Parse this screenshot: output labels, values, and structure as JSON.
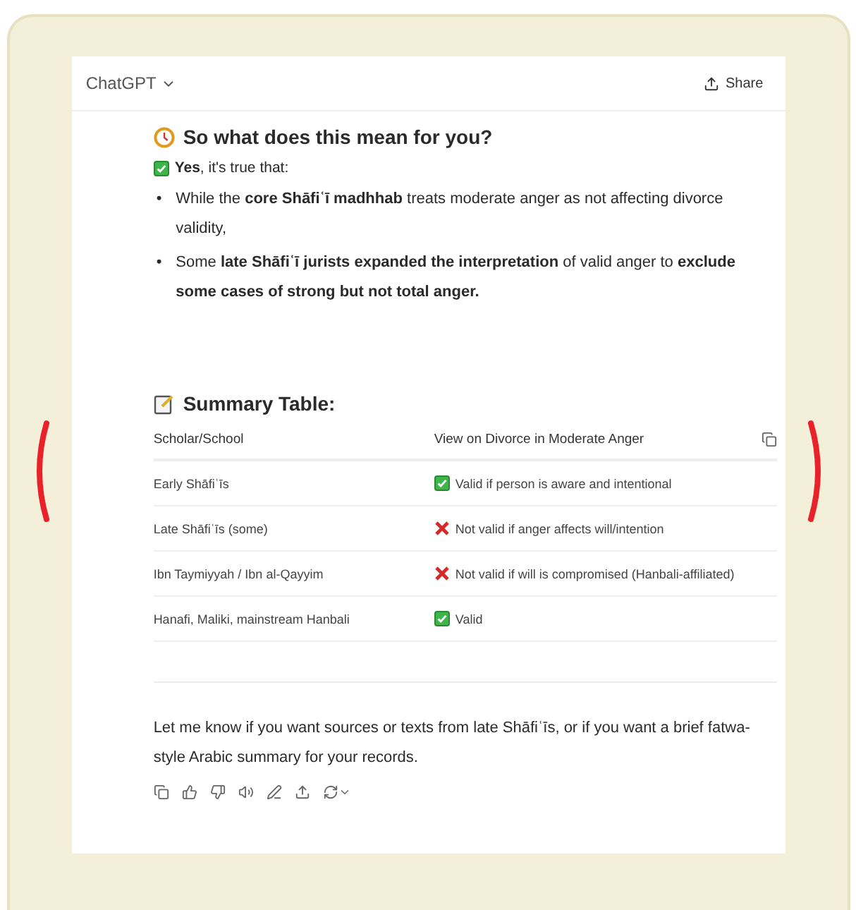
{
  "header": {
    "title": "ChatGPT",
    "share": "Share"
  },
  "section": {
    "heading": "So what does this mean for you?",
    "intro": "**Yes**, it's true that:",
    "bullets": [
      {
        "marker": "•",
        "text": "While the **core Shāfiʿī madhhab** treats moderate anger as not affecting divorce validity,"
      },
      {
        "marker": "•",
        "text": "Some **late Shāfiʿī jurists expanded the interpretation** of valid anger to **exclude some cases of strong but not total anger.**"
      }
    ]
  },
  "summary": {
    "heading": "Summary Table:",
    "columns": [
      "Scholar/School",
      "View on Divorce in Moderate Anger"
    ],
    "rows": [
      {
        "scholar": "Early Shāfiʿīs",
        "kind": "valid",
        "view": "Valid if person is aware and intentional"
      },
      {
        "scholar": "Late Shāfiʿīs (some)",
        "kind": "invalid",
        "view": "Not valid if anger affects will/intention"
      },
      {
        "scholar": "Ibn Taymiyyah / Ibn al-Qayyim",
        "kind": "invalid",
        "view": "Not valid if will is compromised (Hanbali-affiliated)"
      },
      {
        "scholar": "Hanafi, Maliki, mainstream Hanbali",
        "kind": "valid",
        "view": "Valid"
      }
    ]
  },
  "closing": "Let me know if you want sources or texts from late Shāfiʿīs, or if you want a brief fatwa-style Arabic summary for your records."
}
